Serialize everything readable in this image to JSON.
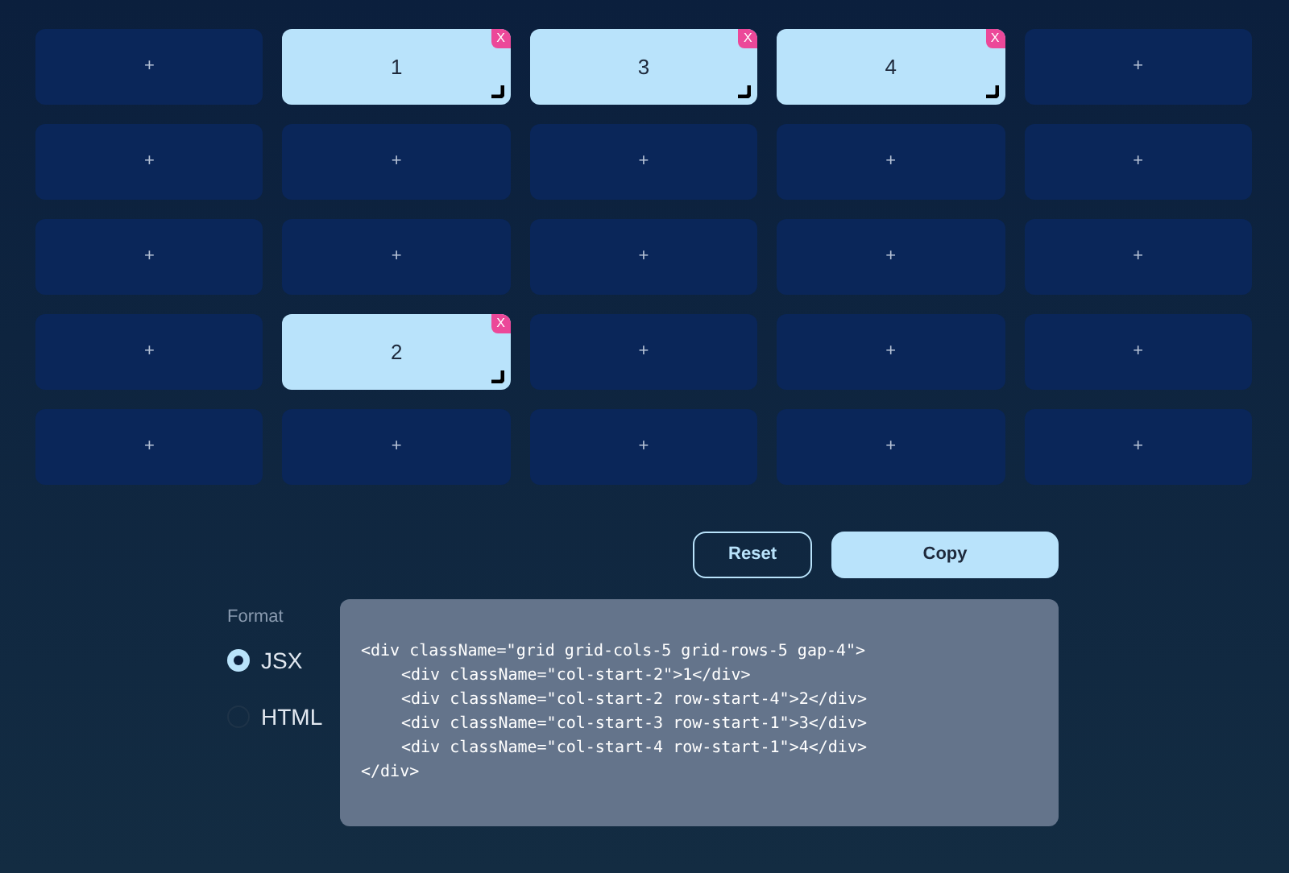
{
  "grid": {
    "cells": [
      {
        "kind": "empty",
        "label": "+"
      },
      {
        "kind": "item",
        "label": "1",
        "remove": "X"
      },
      {
        "kind": "item",
        "label": "3",
        "remove": "X"
      },
      {
        "kind": "item",
        "label": "4",
        "remove": "X"
      },
      {
        "kind": "empty",
        "label": "+"
      },
      {
        "kind": "empty",
        "label": "+"
      },
      {
        "kind": "empty",
        "label": "+"
      },
      {
        "kind": "empty",
        "label": "+"
      },
      {
        "kind": "empty",
        "label": "+"
      },
      {
        "kind": "empty",
        "label": "+"
      },
      {
        "kind": "empty",
        "label": "+"
      },
      {
        "kind": "empty",
        "label": "+"
      },
      {
        "kind": "empty",
        "label": "+"
      },
      {
        "kind": "empty",
        "label": "+"
      },
      {
        "kind": "empty",
        "label": "+"
      },
      {
        "kind": "empty",
        "label": "+"
      },
      {
        "kind": "item",
        "label": "2",
        "remove": "X"
      },
      {
        "kind": "empty",
        "label": "+"
      },
      {
        "kind": "empty",
        "label": "+"
      },
      {
        "kind": "empty",
        "label": "+"
      },
      {
        "kind": "empty",
        "label": "+"
      },
      {
        "kind": "empty",
        "label": "+"
      },
      {
        "kind": "empty",
        "label": "+"
      },
      {
        "kind": "empty",
        "label": "+"
      },
      {
        "kind": "empty",
        "label": "+"
      }
    ]
  },
  "actions": {
    "reset": "Reset",
    "copy": "Copy"
  },
  "format": {
    "label": "Format",
    "options": [
      {
        "label": "JSX",
        "selected": true
      },
      {
        "label": "HTML",
        "selected": false
      }
    ]
  },
  "code": {
    "lines": [
      {
        "text": "<div className=\"grid grid-cols-5 grid-rows-5 gap-4\">",
        "indented": false
      },
      {
        "text": "<div className=\"col-start-2\">1</div>",
        "indented": true
      },
      {
        "text": "<div className=\"col-start-2 row-start-4\">2</div>",
        "indented": true
      },
      {
        "text": "<div className=\"col-start-3 row-start-1\">3</div>",
        "indented": true
      },
      {
        "text": "<div className=\"col-start-4 row-start-1\">4</div>",
        "indented": true
      },
      {
        "text": "</div>",
        "indented": false
      }
    ]
  }
}
